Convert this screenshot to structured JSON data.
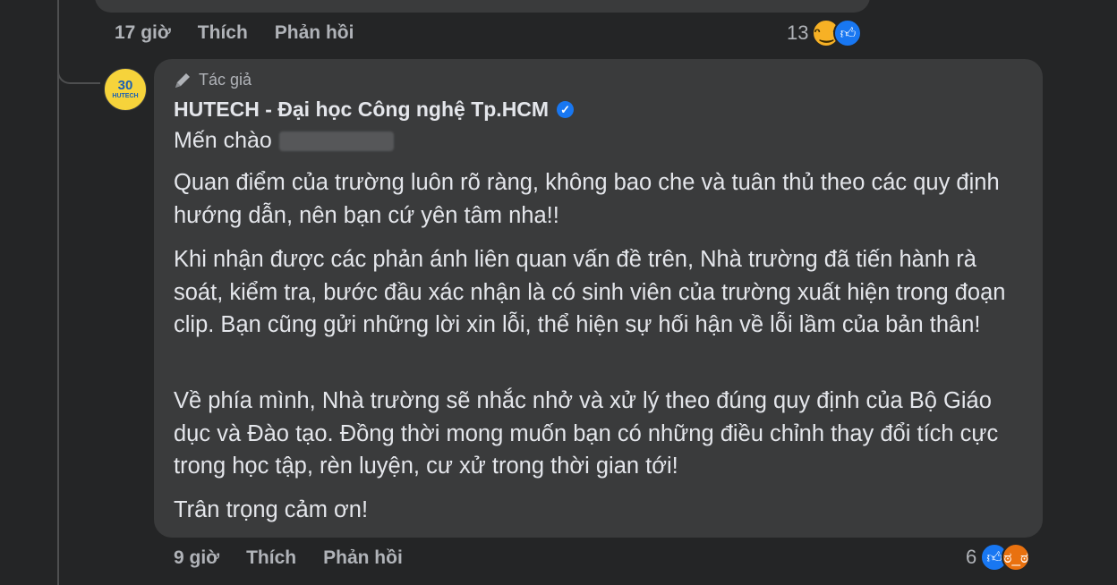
{
  "previous_comment": {
    "time": "17 giờ",
    "like_label": "Thích",
    "reply_label": "Phản hồi",
    "reaction_count": "13",
    "reactions": [
      "haha-reaction-icon",
      "like-reaction-icon"
    ]
  },
  "comment": {
    "author_badge": "Tác giả",
    "author_name": "HUTECH - Đại học Công nghệ Tp.HCM",
    "avatar_text_big": "30",
    "avatar_text_small": "HUTECH",
    "greeting": "Mến chào",
    "paragraphs": [
      "Quan điểm của trường luôn rõ ràng, không bao che và tuân thủ theo các quy định hướng dẫn, nên bạn cứ yên tâm nha!!",
      "Khi nhận được các phản ánh liên quan vấn đề trên, Nhà trường đã tiến hành rà soát, kiểm tra, bước đầu xác nhận là có sinh viên của trường xuất hiện trong đoạn clip. Bạn cũng gửi những lời xin lỗi, thể hiện sự hối hận về lỗi lầm của bản thân!",
      "Về phía mình, Nhà trường sẽ nhắc nhở và xử lý theo đúng quy định của Bộ Giáo dục và Đào tạo. Đồng thời mong muốn bạn có những điều chỉnh thay đổi tích cực trong học tập, rèn luyện, cư xử trong thời gian tới!",
      "Trân trọng cảm ơn!"
    ],
    "time": "9 giờ",
    "like_label": "Thích",
    "reply_label": "Phản hồi",
    "reaction_count": "6",
    "reactions": [
      "like-reaction-icon",
      "angry-reaction-icon"
    ]
  },
  "colors": {
    "background": "#242526",
    "bubble": "#3a3b3c",
    "text_primary": "#e4e6eb",
    "text_secondary": "#b0b3b8",
    "accent_blue": "#1877f2"
  }
}
